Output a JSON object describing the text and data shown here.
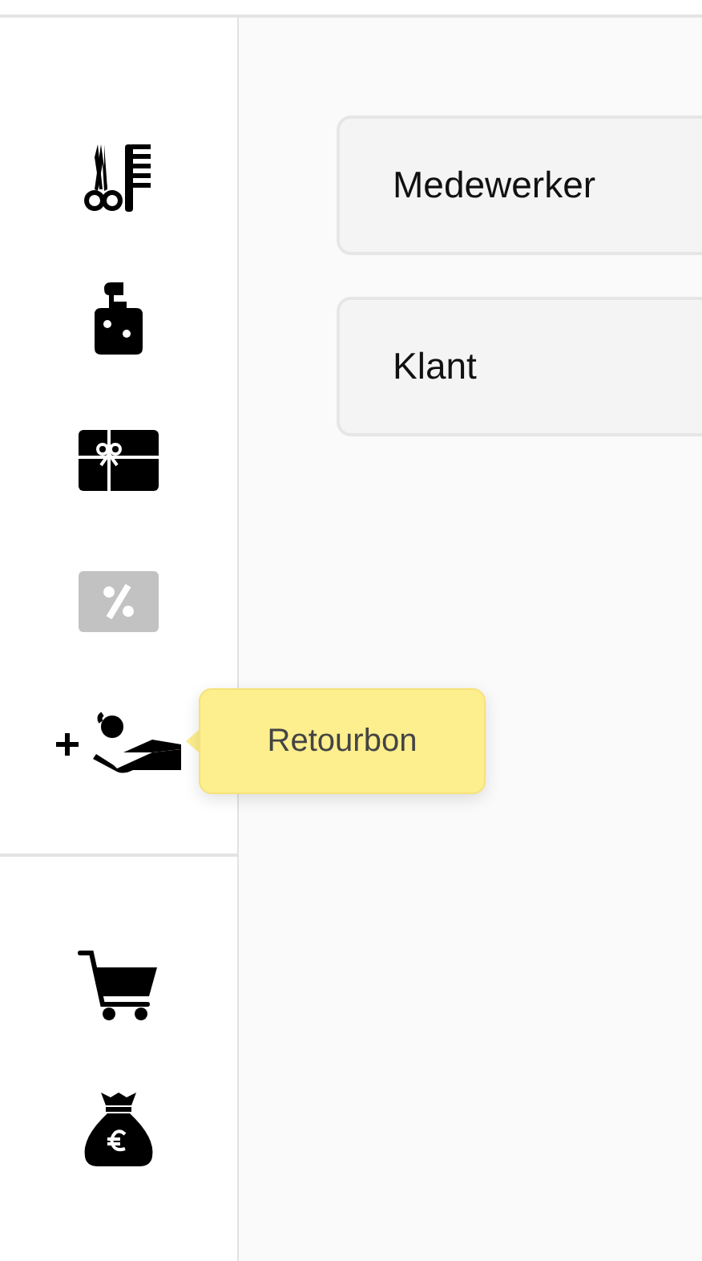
{
  "sidebar": {
    "top_items": [
      {
        "kind": "scissors-comb",
        "disabled": false
      },
      {
        "kind": "soap-bottle",
        "disabled": false
      },
      {
        "kind": "gift-card",
        "disabled": false
      },
      {
        "kind": "percent",
        "disabled": true
      },
      {
        "kind": "add-return",
        "disabled": false,
        "tooltip": "Retourbon"
      }
    ],
    "bottom_items": [
      {
        "kind": "cart",
        "disabled": false
      },
      {
        "kind": "money-bag",
        "disabled": false
      }
    ]
  },
  "fields": [
    {
      "label": "Medewerker"
    },
    {
      "label": "Klant"
    }
  ]
}
